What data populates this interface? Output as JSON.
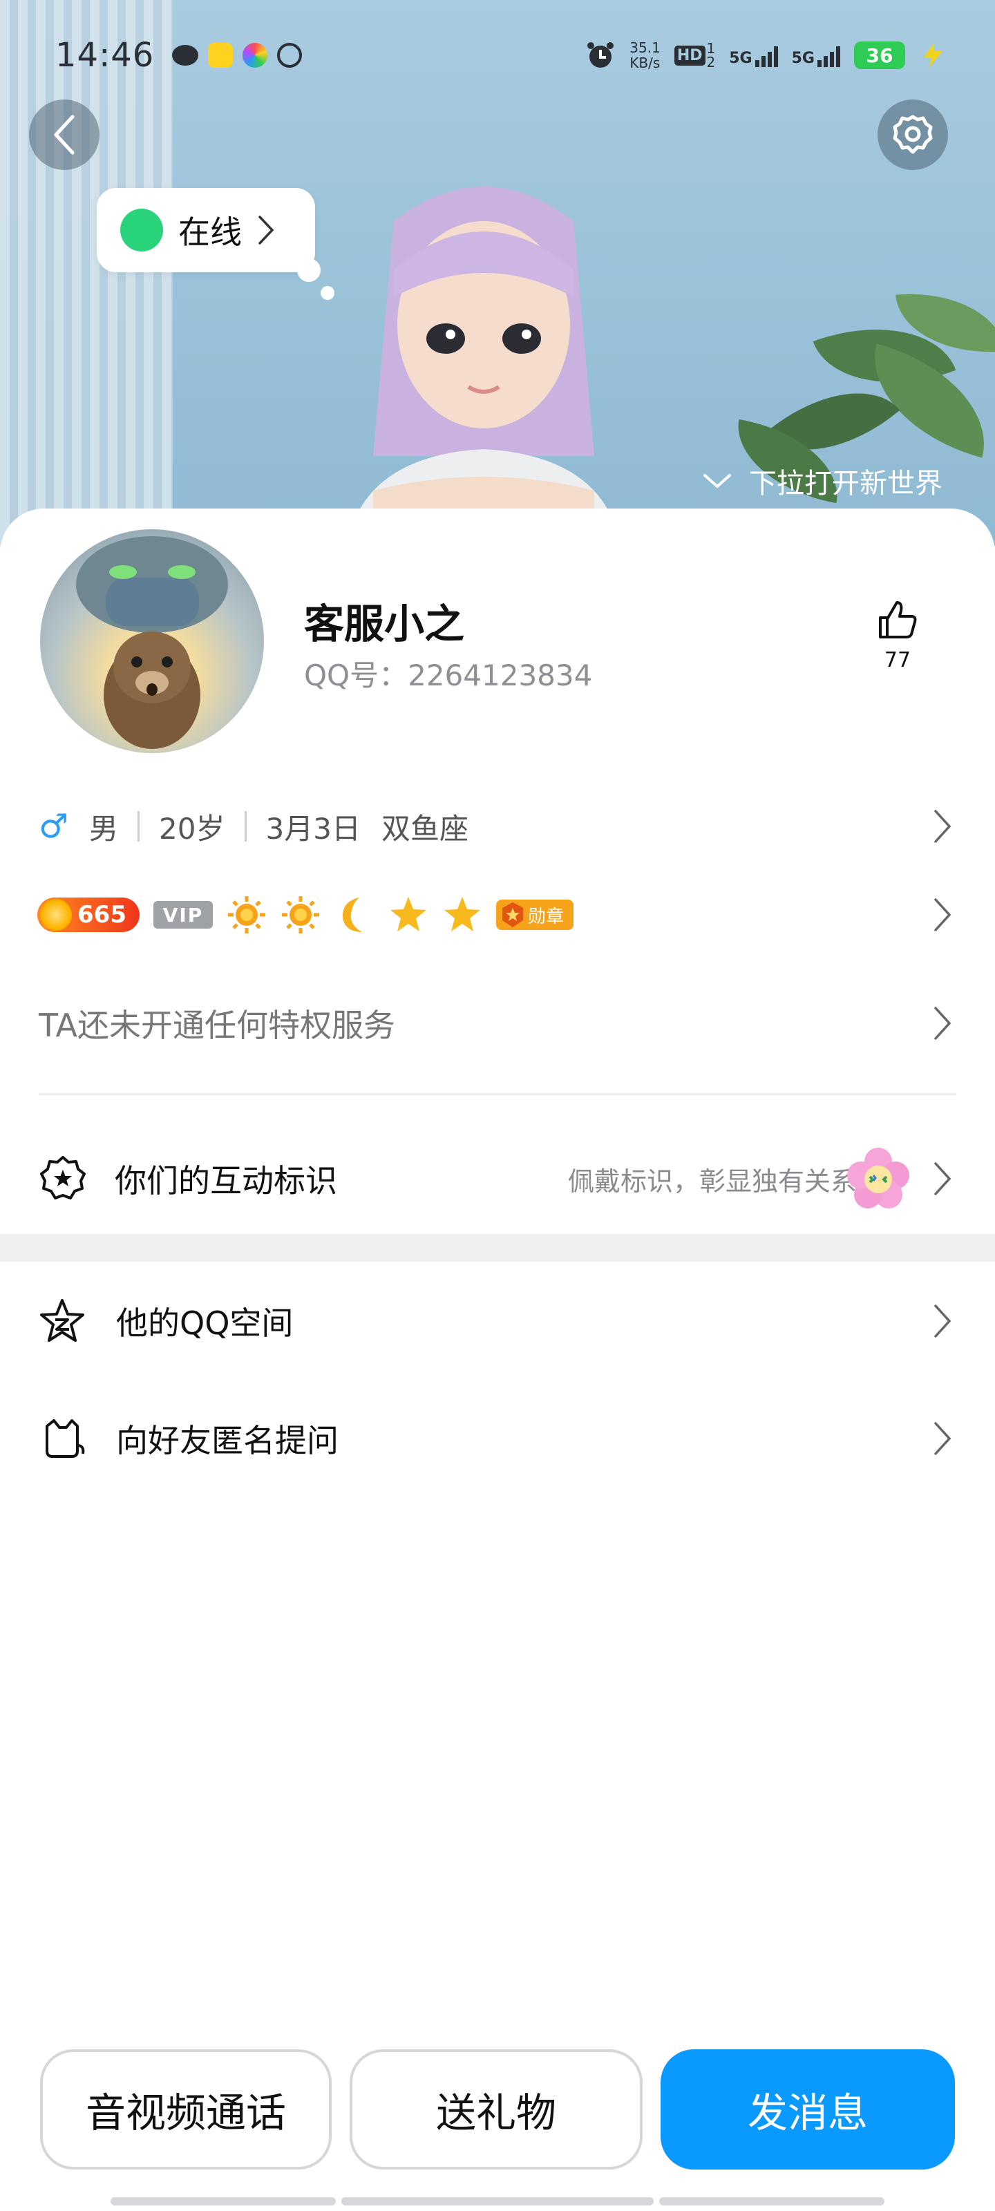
{
  "status_bar": {
    "time": "14:46",
    "net_speed_value": "35.1",
    "net_speed_unit": "KB/s",
    "hd_label": "HD",
    "hd_sub_top": "1",
    "hd_sub_bottom": "2",
    "net1": "5G",
    "net2": "5G",
    "battery": "36"
  },
  "hero": {
    "online_status": "在线",
    "pull_hint": "下拉打开新世界"
  },
  "profile": {
    "nickname": "客服小之",
    "qq_label": "QQ号：2264123834",
    "like_count": "77"
  },
  "info": {
    "gender": "男",
    "age": "20岁",
    "birthday": "3月3日",
    "zodiac": "双鱼座"
  },
  "badges": {
    "level": "665",
    "vip": "VIP",
    "medal": "勋章"
  },
  "privilege_text": "TA还未开通任何特权服务",
  "interaction_mark": {
    "title": "你们的互动标识",
    "desc": "佩戴标识，彰显独有关系"
  },
  "list": {
    "zone": "他的QQ空间",
    "ask": "向好友匿名提问"
  },
  "actions": {
    "call": "音视频通话",
    "gift": "送礼物",
    "message": "发消息"
  },
  "colors": {
    "accent": "#0a99ff",
    "online": "#29d37b",
    "male": "#2a9cf3",
    "level_badge": "#f0361c",
    "medal_badge": "#f7a21b"
  }
}
